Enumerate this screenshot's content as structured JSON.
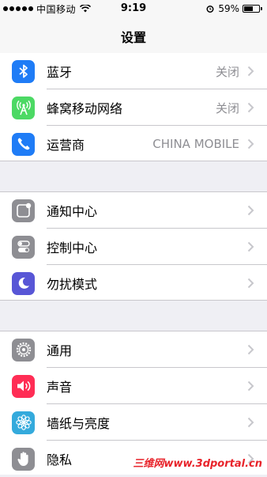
{
  "status_bar": {
    "carrier": "中国移动",
    "time": "9:19",
    "battery_percent_text": "59%",
    "battery_level": 0.59,
    "signal_dots": 5
  },
  "nav": {
    "title": "设置"
  },
  "colors": {
    "bluetooth": "#1f7cf6",
    "cellular": "#4cd964",
    "carrier": "#1f7cf6",
    "notifications": "#8e8e93",
    "control_center": "#8e8e93",
    "do_not_disturb": "#5856d6",
    "general": "#8e8e93",
    "sounds": "#ff2d55",
    "wallpaper": "#34aadc",
    "privacy": "#8e8e93"
  },
  "groups": [
    {
      "items": [
        {
          "label": "蓝牙",
          "value": "关闭",
          "icon": "bluetooth-icon"
        },
        {
          "label": "蜂窝移动网络",
          "value": "关闭",
          "icon": "cellular-antenna-icon"
        },
        {
          "label": "运营商",
          "value": "CHINA MOBILE",
          "icon": "phone-icon"
        }
      ]
    },
    {
      "items": [
        {
          "label": "通知中心",
          "icon": "notification-center-icon"
        },
        {
          "label": "控制中心",
          "icon": "control-center-icon"
        },
        {
          "label": "勿扰模式",
          "icon": "moon-icon"
        }
      ]
    },
    {
      "items": [
        {
          "label": "通用",
          "icon": "gear-icon"
        },
        {
          "label": "声音",
          "icon": "speaker-icon"
        },
        {
          "label": "墙纸与亮度",
          "icon": "flower-icon"
        },
        {
          "label": "隐私",
          "icon": "hand-icon"
        }
      ]
    }
  ],
  "watermark": "三维网www.3dportal.cn"
}
